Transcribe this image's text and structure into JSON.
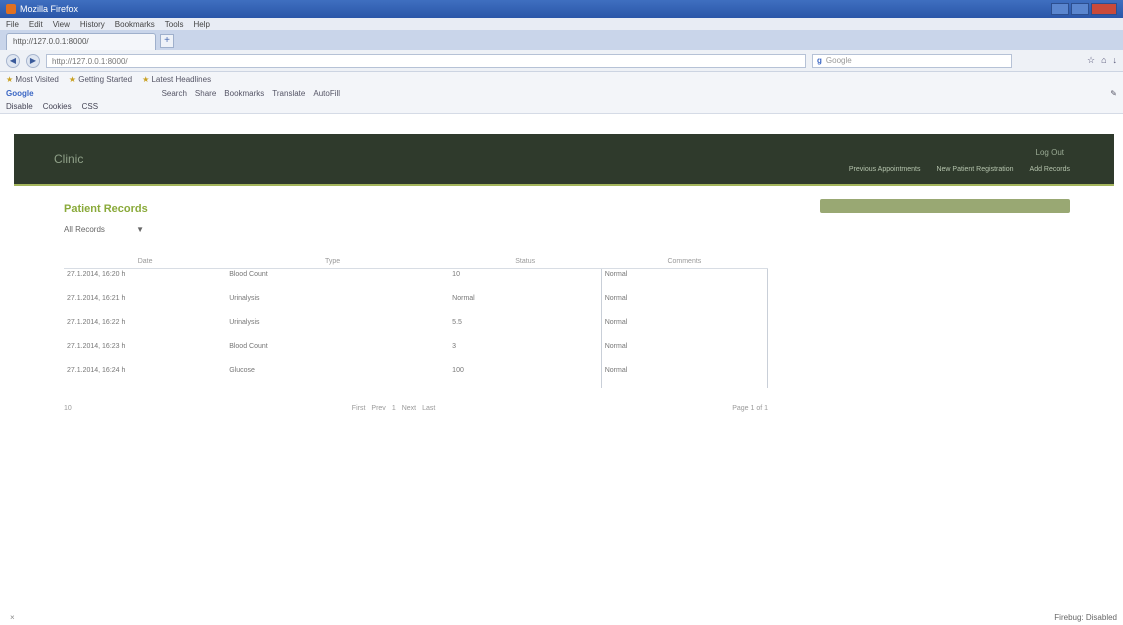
{
  "browser": {
    "window_title": "Mozilla Firefox",
    "menu": [
      "File",
      "Edit",
      "View",
      "History",
      "Bookmarks",
      "Tools",
      "Help"
    ],
    "tab_title": "http://127.0.0.1:8000/",
    "new_tab_symbol": "+",
    "url": "http://127.0.0.1:8000/",
    "search_engine": "g",
    "search_placeholder": "Google",
    "bookmarks": [
      "Most Visited",
      "Getting Started",
      "Latest Headlines"
    ],
    "google_toolbar": {
      "logo": "Google",
      "items": [
        "Search",
        "Share",
        "Bookmarks",
        "Translate",
        "AutoFill"
      ]
    },
    "webext_toolbar": [
      "Disable",
      "Cookies",
      "CSS"
    ],
    "status_left": "×",
    "status_right": "Firebug: Disabled"
  },
  "app": {
    "brand": "Clinic",
    "user_link": "Log Out",
    "nav": [
      "Previous Appointments",
      "New Patient Registration",
      "Add Records"
    ],
    "page_title": "Patient Records",
    "filter_value": "All Records",
    "filter_arrow": "▼",
    "table": {
      "headers": [
        "Date",
        "Type",
        "",
        "Status",
        "Comments"
      ],
      "rows": [
        {
          "date": "27.1.2014, 16:20 h",
          "type": "Blood Count",
          "value": "10",
          "comments": "Normal"
        },
        {
          "date": "27.1.2014, 16:21 h",
          "type": "Urinalysis",
          "value": "Normal",
          "comments": "Normal"
        },
        {
          "date": "27.1.2014, 16:22 h",
          "type": "Urinalysis",
          "value": "5.5",
          "comments": "Normal"
        },
        {
          "date": "27.1.2014, 16:23 h",
          "type": "Blood Count",
          "value": "3",
          "comments": "Normal"
        },
        {
          "date": "27.1.2014, 16:24 h",
          "type": "Glucose",
          "value": "100",
          "comments": "Normal"
        }
      ]
    },
    "pager": {
      "left": "10",
      "items": [
        "First",
        "Prev",
        "1",
        "Next",
        "Last"
      ],
      "right": "Page 1 of 1"
    }
  },
  "colors": {
    "header_bg": "#2f3a2c",
    "accent": "#a4b55c",
    "title": "#8aaa3a"
  }
}
